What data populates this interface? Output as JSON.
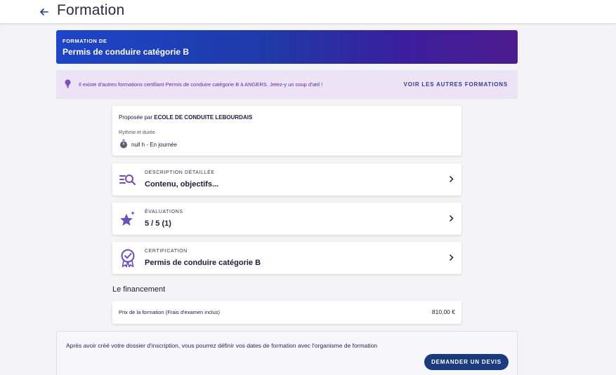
{
  "header": {
    "back_icon": "arrow-left-icon",
    "title": "Formation"
  },
  "hero": {
    "label": "FORMATION DE",
    "title": "Permis de conduire catégorie B",
    "gradient_colors": [
      "#1d45c8",
      "#4d1b8f"
    ]
  },
  "notice": {
    "icon": "lightbulb-icon",
    "text": "Il existe d'autres formations certifiant Permis de conduire catégorie B à ANGERS. Jetez-y un coup d'œil !",
    "link_label": "VOIR LES AUTRES FORMATIONS"
  },
  "provider": {
    "prefix": "Proposée par",
    "name": "ECOLE DE CONDUITE LEBOURDAIS",
    "rhythm_label": "Rythme et durée",
    "rhythm_icon": "timer-icon",
    "rhythm_value": "null h - En journée"
  },
  "cards": [
    {
      "icon": "search-list-icon",
      "overline": "DESCRIPTION DÉTAILLÉE",
      "title": "Contenu, objectifs..."
    },
    {
      "icon": "stars-icon",
      "overline": "ÉVALUATIONS",
      "title": "5 / 5 (1)"
    },
    {
      "icon": "certificate-badge-icon",
      "overline": "CERTIFICATION",
      "title": "Permis de conduire catégorie B"
    }
  ],
  "financing": {
    "title": "Le financement",
    "price_label": "Prix de la formation (Frais d'examen inclus)",
    "price_value": "810,00 €"
  },
  "footer": {
    "text": "Après avoir créé votre dossier d'inscription, vous pourrez définir vos dates de formation avec l'organisme de formation",
    "button_label": "DEMANDER UN DEVIS",
    "button_color": "#1a3b7e"
  },
  "colors": {
    "accent_purple": "#6b4fbb",
    "notice_bg": "#ece4f6",
    "page_bg": "#f4f4f6"
  }
}
